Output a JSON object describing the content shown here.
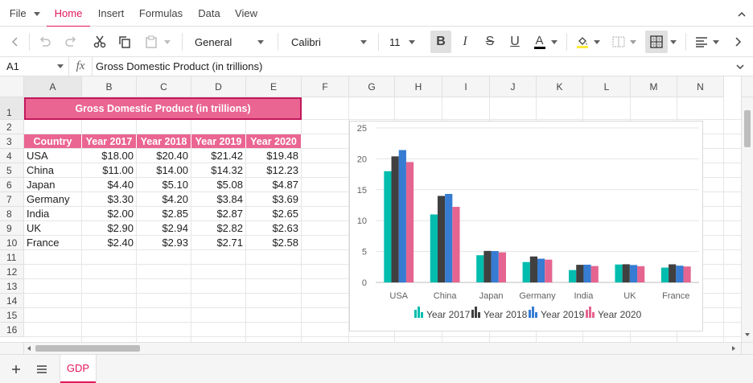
{
  "ribbon": {
    "file_label": "File",
    "tabs": [
      "Home",
      "Insert",
      "Formulas",
      "Data",
      "View"
    ],
    "active_tab": "Home"
  },
  "toolbar": {
    "number_format": "General",
    "font_family": "Calibri",
    "font_size": "11",
    "font_color_letter": "A",
    "underline_letter": "U",
    "bold_letter": "B",
    "italic_letter": "I",
    "strike_letter": "S",
    "font_color": "#000000",
    "fill_color": "#ffeb3b"
  },
  "formula_bar": {
    "name_box": "A1",
    "fx_label": "fx",
    "formula": "Gross Domestic Product (in trillions)"
  },
  "columns": [
    "A",
    "B",
    "C",
    "D",
    "E",
    "F",
    "G",
    "H",
    "I",
    "J",
    "K",
    "L",
    "M",
    "N"
  ],
  "rows": [
    "1",
    "2",
    "3",
    "4",
    "5",
    "6",
    "7",
    "8",
    "9",
    "10",
    "11",
    "12",
    "13",
    "14",
    "15",
    "16"
  ],
  "sheet": {
    "title": "Gross Domestic Product (in trillions)",
    "headers": [
      "Country",
      "Year 2017",
      "Year 2018",
      "Year 2019",
      "Year 2020"
    ],
    "data": [
      [
        "USA",
        "$18.00",
        "$20.40",
        "$21.42",
        "$19.48"
      ],
      [
        "China",
        "$11.00",
        "$14.00",
        "$14.32",
        "$12.23"
      ],
      [
        "Japan",
        "$4.40",
        "$5.10",
        "$5.08",
        "$4.87"
      ],
      [
        "Germany",
        "$3.30",
        "$4.20",
        "$3.84",
        "$3.69"
      ],
      [
        "India",
        "$2.00",
        "$2.85",
        "$2.87",
        "$2.65"
      ],
      [
        "UK",
        "$2.90",
        "$2.94",
        "$2.82",
        "$2.63"
      ],
      [
        "France",
        "$2.40",
        "$2.93",
        "$2.71",
        "$2.58"
      ]
    ],
    "header_color": "#ea6591"
  },
  "chart_data": {
    "type": "bar",
    "categories": [
      "USA",
      "China",
      "Japan",
      "Germany",
      "India",
      "UK",
      "France"
    ],
    "series": [
      {
        "name": "Year 2017",
        "color": "#00bdae",
        "values": [
          18.0,
          11.0,
          4.4,
          3.3,
          2.0,
          2.9,
          2.4
        ]
      },
      {
        "name": "Year 2018",
        "color": "#404041",
        "values": [
          20.4,
          14.0,
          5.1,
          4.2,
          2.85,
          2.94,
          2.93
        ]
      },
      {
        "name": "Year 2019",
        "color": "#357cd2",
        "values": [
          21.42,
          14.32,
          5.08,
          3.84,
          2.87,
          2.82,
          2.71
        ]
      },
      {
        "name": "Year 2020",
        "color": "#e56590",
        "values": [
          19.48,
          12.23,
          4.87,
          3.69,
          2.65,
          2.63,
          2.58
        ]
      }
    ],
    "yticks": [
      0,
      5,
      10,
      15,
      20,
      25
    ],
    "ylim": [
      0,
      25
    ],
    "grid": true,
    "legend_position": "bottom",
    "title": "",
    "xlabel": "",
    "ylabel": ""
  },
  "sheet_tabs": {
    "active": "GDP"
  }
}
